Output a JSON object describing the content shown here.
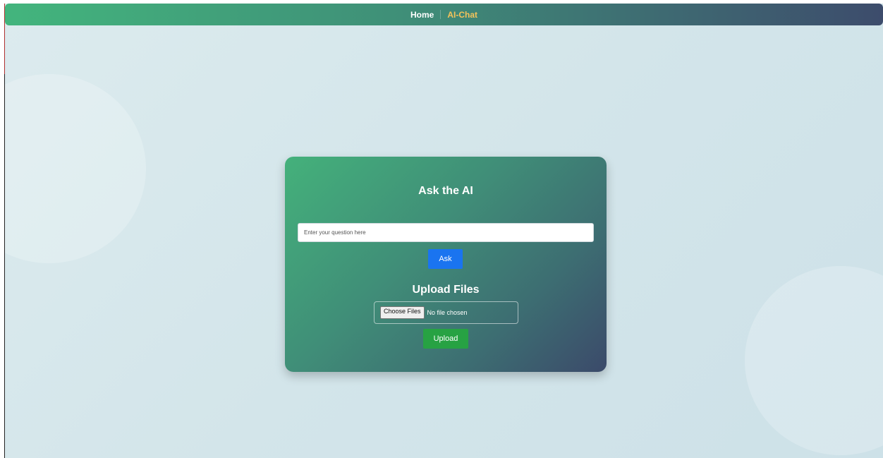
{
  "nav": {
    "items": [
      {
        "label": "Home",
        "active": false
      },
      {
        "label": "AI-Chat",
        "active": true
      }
    ],
    "active_color": "#f4c35a"
  },
  "ask": {
    "title": "Ask the AI",
    "input_placeholder": "Enter your question here",
    "input_value": "",
    "button_label": "Ask",
    "button_color": "#1a74f0"
  },
  "upload": {
    "title": "Upload Files",
    "choose_button_label": "Choose Files",
    "file_status": "No file chosen",
    "button_label": "Upload",
    "button_color": "#27a243"
  }
}
